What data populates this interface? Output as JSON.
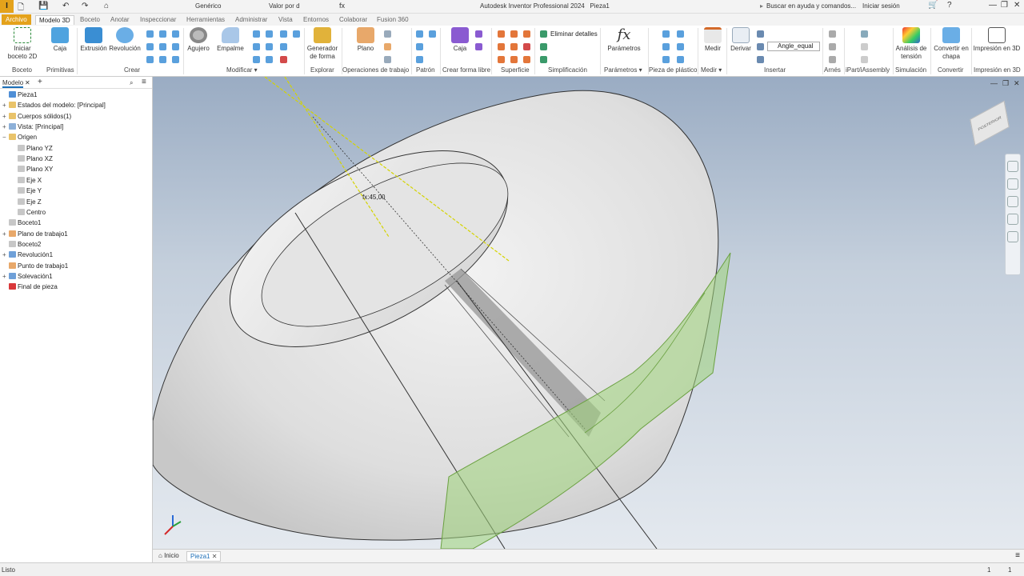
{
  "app": {
    "logo": "I",
    "title": "Autodesk Inventor Professional 2024",
    "document": "Pieza1",
    "appearance": "Genérico",
    "material": "Valor por d",
    "search_placeholder": "Buscar en ayuda y comandos...",
    "signin": "Iniciar sesión"
  },
  "tabs": [
    "Archivo",
    "Modelo 3D",
    "Boceto",
    "Anotar",
    "Inspeccionar",
    "Herramientas",
    "Administrar",
    "Vista",
    "Entornos",
    "Colaborar",
    "Fusion 360"
  ],
  "ribbon": {
    "buttons": {
      "start_sketch": "Iniciar boceto 2D",
      "box": "Caja",
      "extrude": "Extrusión",
      "revolve": "Revolución",
      "hole": "Agujero",
      "fillet": "Empalme",
      "shape_gen": "Generador de forma",
      "plane": "Plano",
      "freeform_box": "Caja",
      "remove_details": "Eliminar detalles",
      "params": "Parámetros",
      "measure": "Medir",
      "derive": "Derivar",
      "angle_equal": "Angle_equal",
      "stress": "Análisis de tensión",
      "sheetmetal": "Convertir en chapa",
      "print3d": "Impresión en 3D"
    },
    "panels": {
      "sketch": "Boceto",
      "primitives": "Primitivas",
      "create": "Crear",
      "modify": "Modificar ▾",
      "explore": "Explorar",
      "workfeatures": "Operaciones de trabajo",
      "pattern": "Patrón",
      "freeform": "Crear forma libre",
      "surface": "Superficie",
      "simplification": "Simplificación",
      "parameters": "Parámetros ▾",
      "plastic": "Pieza de plástico",
      "measure": "Medir ▾",
      "insert": "Insertar",
      "harness": "Arnés",
      "ipart": "iPart/iAssembly",
      "simulation": "Simulación",
      "convert": "Convertir",
      "print3d": "Impresión en 3D"
    }
  },
  "browser": {
    "title": "Modelo",
    "items": [
      {
        "label": "Pieza1",
        "level": 0,
        "exp": "",
        "color": "#4f8fd6"
      },
      {
        "label": "Estados del modelo: [Principal]",
        "level": 0,
        "exp": "+",
        "color": "#e9c36a"
      },
      {
        "label": "Cuerpos sólidos(1)",
        "level": 0,
        "exp": "+",
        "color": "#e9c36a"
      },
      {
        "label": "Vista: [Principal]",
        "level": 0,
        "exp": "+",
        "color": "#8db0d8"
      },
      {
        "label": "Origen",
        "level": 0,
        "exp": "−",
        "color": "#e9c36a"
      },
      {
        "label": "Plano YZ",
        "level": 1,
        "exp": "",
        "color": "#c7c7c7"
      },
      {
        "label": "Plano XZ",
        "level": 1,
        "exp": "",
        "color": "#c7c7c7"
      },
      {
        "label": "Plano XY",
        "level": 1,
        "exp": "",
        "color": "#c7c7c7"
      },
      {
        "label": "Eje X",
        "level": 1,
        "exp": "",
        "color": "#c7c7c7"
      },
      {
        "label": "Eje Y",
        "level": 1,
        "exp": "",
        "color": "#c7c7c7"
      },
      {
        "label": "Eje Z",
        "level": 1,
        "exp": "",
        "color": "#c7c7c7"
      },
      {
        "label": "Centro",
        "level": 1,
        "exp": "",
        "color": "#c7c7c7"
      },
      {
        "label": "Boceto1",
        "level": 0,
        "exp": "",
        "color": "#c7c7c7"
      },
      {
        "label": "Plano de trabajo1",
        "level": 0,
        "exp": "+",
        "color": "#e8a86a"
      },
      {
        "label": "Boceto2",
        "level": 0,
        "exp": "",
        "color": "#c7c7c7"
      },
      {
        "label": "Revolución1",
        "level": 0,
        "exp": "+",
        "color": "#6fa0d8"
      },
      {
        "label": "Punto de trabajo1",
        "level": 0,
        "exp": "",
        "color": "#e8a86a"
      },
      {
        "label": "Solevación1",
        "level": 0,
        "exp": "+",
        "color": "#6fa0d8"
      },
      {
        "label": "Final de pieza",
        "level": 0,
        "exp": "",
        "color": "#d9383a"
      }
    ]
  },
  "viewport": {
    "dimension": "fx:45,00",
    "viewcube_label": "POSTERIOR"
  },
  "doc_tabs": {
    "home": "Inicio",
    "active": "Pieza1"
  },
  "status": {
    "text": "Listo",
    "count1": "1",
    "count2": "1"
  }
}
